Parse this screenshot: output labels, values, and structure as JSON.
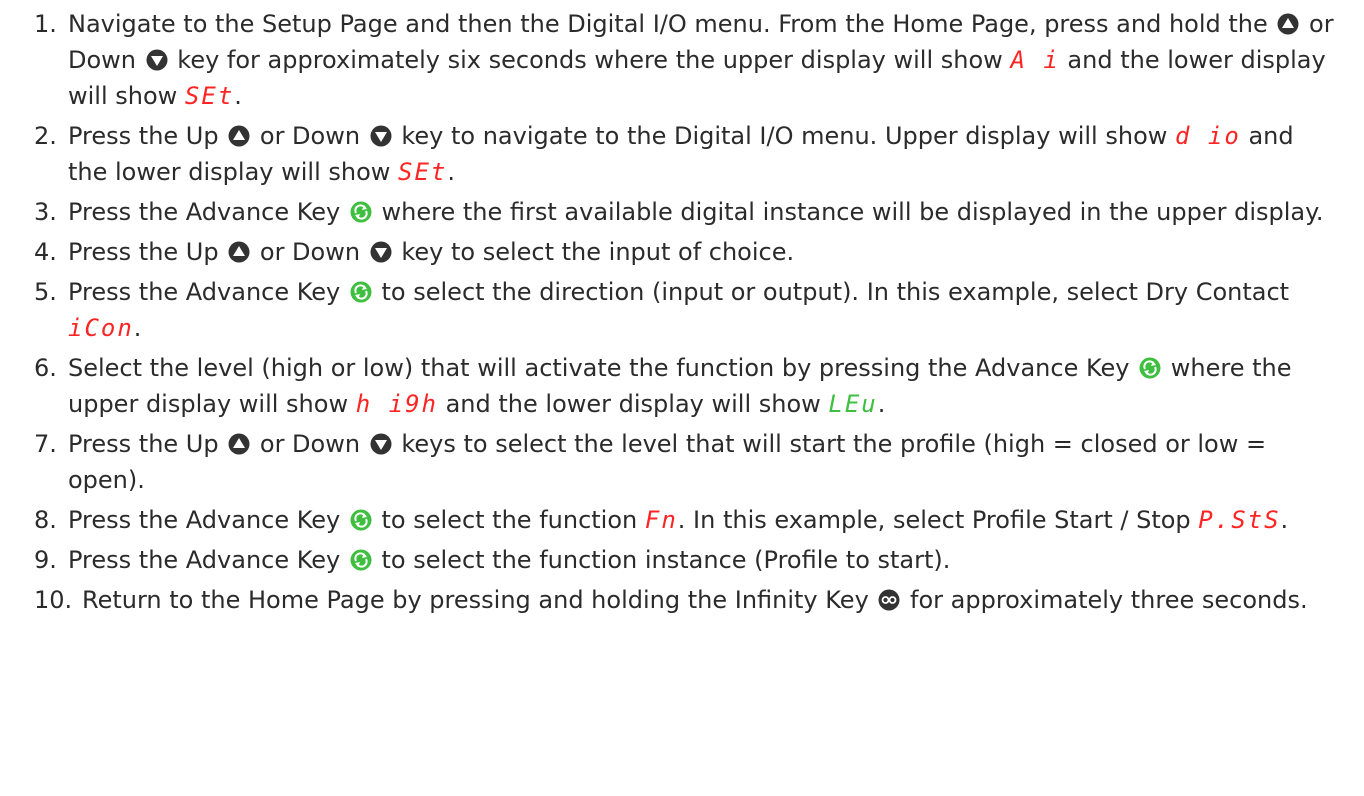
{
  "steps": [
    {
      "num": "1.",
      "t1": "Navigate to the Setup Page and then the Digital I/O menu. From the Home Page, press and hold the ",
      "t2": " or Down ",
      "t3": " key for approximately six seconds where the upper display will show ",
      "seg1": "A i",
      "t4": " and the lower display will show ",
      "seg2": "SEt",
      "t5": "."
    },
    {
      "num": "2.",
      "t1": "Press the Up ",
      "t2": " or Down ",
      "t3": " key to navigate to the Digital I/O  menu. Upper display will show ",
      "seg1": "d io",
      "t4": " and the lower display will show ",
      "seg2": "SEt",
      "t5": "."
    },
    {
      "num": "3.",
      "t1": "Press the Advance Key ",
      "t2": " where the first available digital instance will be displayed in the upper display."
    },
    {
      "num": "4.",
      "t1": "Press the Up ",
      "t2": "  or Down ",
      "t3": " key to select the input of choice."
    },
    {
      "num": "5.",
      "t1": "Press the Advance Key ",
      "t2": " to select the direction (input or output). In this example, select Dry Contact ",
      "seg1": "iCon",
      "t3": "."
    },
    {
      "num": "6.",
      "t1": "Select the level (high or low) that will activate the function by pressing the Advance Key ",
      "t2": " where the upper display will show ",
      "seg1": "h i9h",
      "t3": " and the lower display will show ",
      "seg2": "LEu",
      "t4": "."
    },
    {
      "num": "7.",
      "t1": "Press the Up ",
      "t2": " or Down ",
      "t3": " keys to select the level that will start the profile (high = closed or low = open)."
    },
    {
      "num": "8.",
      "t1": "Press the Advance Key ",
      "t2": " to select the function ",
      "seg1": "Fn",
      "t3": ". In this example, select Profile Start / Stop ",
      "seg2": "P.StS",
      "t4": "."
    },
    {
      "num": "9.",
      "t1": "Press the Advance Key ",
      "t2": " to select the function instance (Profile to start)."
    },
    {
      "num": "10.",
      "t1": "Return to the Home Page by pressing and holding the Infinity Key ",
      "t2": " for approximately three seconds."
    }
  ],
  "colors": {
    "text": "#2b2b2b",
    "display_red": "#ff2424",
    "advance_green": "#3fbf3f",
    "key_dark": "#333333"
  },
  "icons": {
    "up": "up-arrow-key-icon",
    "down": "down-arrow-key-icon",
    "advance": "advance-key-icon",
    "infinity": "infinity-key-icon"
  }
}
